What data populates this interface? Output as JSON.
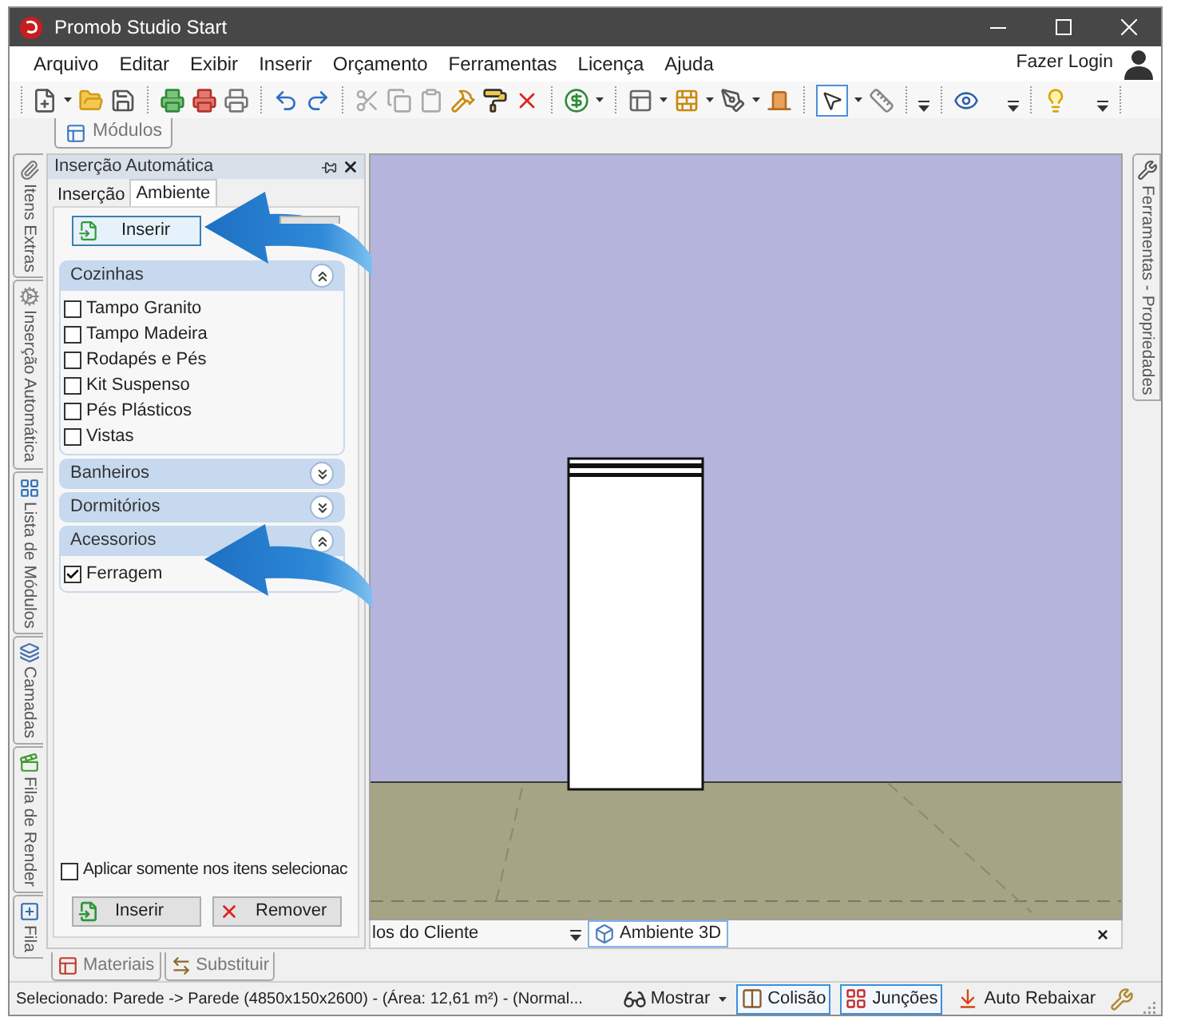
{
  "window": {
    "title": "Promob Studio Start"
  },
  "menu": [
    "Arquivo",
    "Editar",
    "Exibir",
    "Inserir",
    "Orçamento",
    "Ferramentas",
    "Licença",
    "Ajuda"
  ],
  "account": {
    "label": "Fazer Login"
  },
  "toolbar_tabs": [
    {
      "label": "Módulos"
    }
  ],
  "left_dock_tabs": [
    {
      "kind": "extras",
      "label": "Itens Extras"
    },
    {
      "kind": "automation",
      "label": "Inserção Automática"
    },
    {
      "kind": "modules",
      "label": "Lista de Módulos"
    },
    {
      "kind": "layers",
      "label": "Camadas"
    },
    {
      "kind": "render",
      "label": "Fila de Render"
    },
    {
      "kind": "queue",
      "label": "Fila"
    }
  ],
  "panel": {
    "title": "Inserção Automática",
    "tabs": [
      {
        "label": "Inserção",
        "selected": false
      },
      {
        "label": "Ambiente",
        "selected": true
      }
    ],
    "top_button": {
      "label": "Inserir"
    },
    "groups": [
      {
        "title": "Cozinhas",
        "expanded": true,
        "items": [
          {
            "label": "Tampo Granito",
            "checked": false
          },
          {
            "label": "Tampo Madeira",
            "checked": false
          },
          {
            "label": "Rodapés e Pés",
            "checked": false
          },
          {
            "label": "Kit Suspenso",
            "checked": false
          },
          {
            "label": "Pés Plásticos",
            "checked": false
          },
          {
            "label": "Vistas",
            "checked": false
          }
        ]
      },
      {
        "title": "Banheiros",
        "expanded": false
      },
      {
        "title": "Dormitórios",
        "expanded": false
      },
      {
        "title": "Acessorios",
        "expanded": true,
        "items": [
          {
            "label": "Ferragem",
            "checked": true
          }
        ]
      }
    ],
    "apply_option": {
      "label": "Aplicar somente nos itens selecionac",
      "checked": false
    },
    "buttons": [
      {
        "kind": "insert",
        "label": "Inserir"
      },
      {
        "kind": "remove",
        "label": "Remover"
      }
    ]
  },
  "panel_tabs": [
    {
      "kind": "materials",
      "label": "Materiais"
    },
    {
      "kind": "replace",
      "label": "Substituir"
    }
  ],
  "document_tabs": [
    {
      "kind": "list",
      "label": "los do Cliente",
      "selected": false
    },
    {
      "kind": "view3d",
      "label": "Ambiente 3D",
      "selected": true
    }
  ],
  "document_close": "×",
  "right_dock_tabs": [
    {
      "label": "Ferramentas - Propriedades"
    }
  ],
  "status_bar": {
    "text": "Selecionado: Parede -> Parede (4850x150x2600) - (Área: 12,61 m²) - (Normal...",
    "show_menu": "Mostrar",
    "toggles": [
      {
        "kind": "collision",
        "label": "Colisão",
        "on": true
      },
      {
        "kind": "joints",
        "label": "Junções",
        "on": true
      },
      {
        "kind": "auto_lower",
        "label": "Auto Rebaixar",
        "on": false
      }
    ]
  }
}
